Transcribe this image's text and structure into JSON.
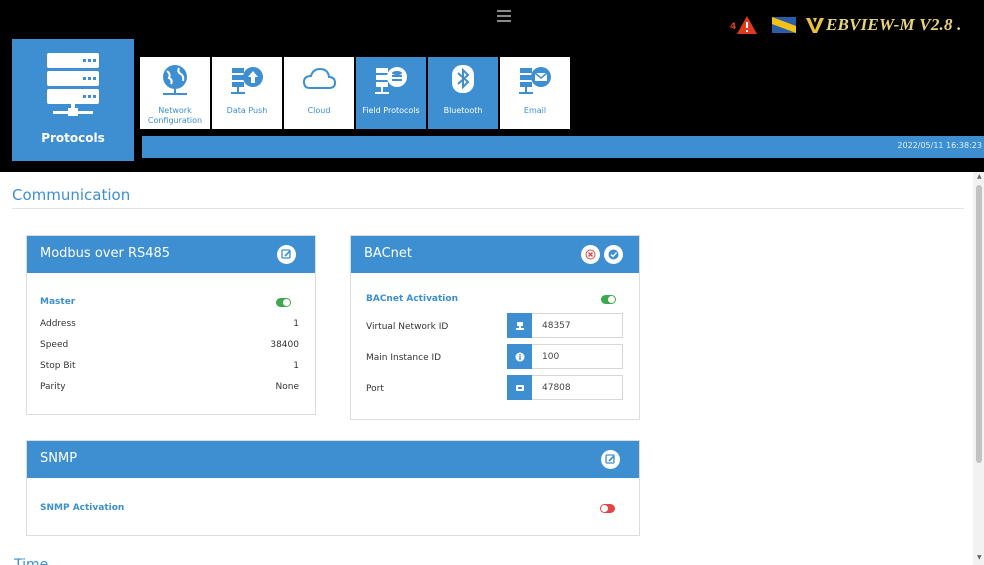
{
  "header": {
    "brand_text": "EBVIEW-M V2.8 .",
    "warning_count": "4",
    "datetime": "2022/05/11 16:38:23",
    "protocols_label": "Protocols",
    "tabs": [
      {
        "label": "Network Configuration",
        "icon": "globe-icon",
        "active": false
      },
      {
        "label": "Data Push",
        "icon": "upload-server-icon",
        "active": false
      },
      {
        "label": "Cloud",
        "icon": "cloud-icon",
        "active": false
      },
      {
        "label": "Field Protocols",
        "icon": "database-server-icon",
        "active": true
      },
      {
        "label": "Bluetooth",
        "icon": "bluetooth-icon",
        "active": false
      },
      {
        "label": "Email",
        "icon": "email-server-icon",
        "active": false
      }
    ]
  },
  "communication": {
    "title": "Communication",
    "modbus": {
      "title": "Modbus over RS485",
      "master_label": "Master",
      "master_enabled": true,
      "rows": [
        {
          "label": "Address",
          "value": "1"
        },
        {
          "label": "Speed",
          "value": "38400"
        },
        {
          "label": "Stop Bit",
          "value": "1"
        },
        {
          "label": "Parity",
          "value": "None"
        }
      ]
    },
    "bacnet": {
      "title": "BACnet",
      "activation_label": "BACnet Activation",
      "activation_enabled": true,
      "fields": [
        {
          "label": "Virtual Network ID",
          "value": "48357",
          "icon": "network-icon"
        },
        {
          "label": "Main Instance ID",
          "value": "100",
          "icon": "info-icon"
        },
        {
          "label": "Port",
          "value": "47808",
          "icon": "port-icon"
        }
      ]
    },
    "snmp": {
      "title": "SNMP",
      "activation_label": "SNMP Activation",
      "activation_enabled": false
    }
  },
  "time_section_title": "Time",
  "colors": {
    "accent": "#3d8fd2",
    "toggle_on": "#3ea84f",
    "toggle_off": "#e04848",
    "header_bg": "#000000",
    "brand_gold": "#e8d47a"
  }
}
